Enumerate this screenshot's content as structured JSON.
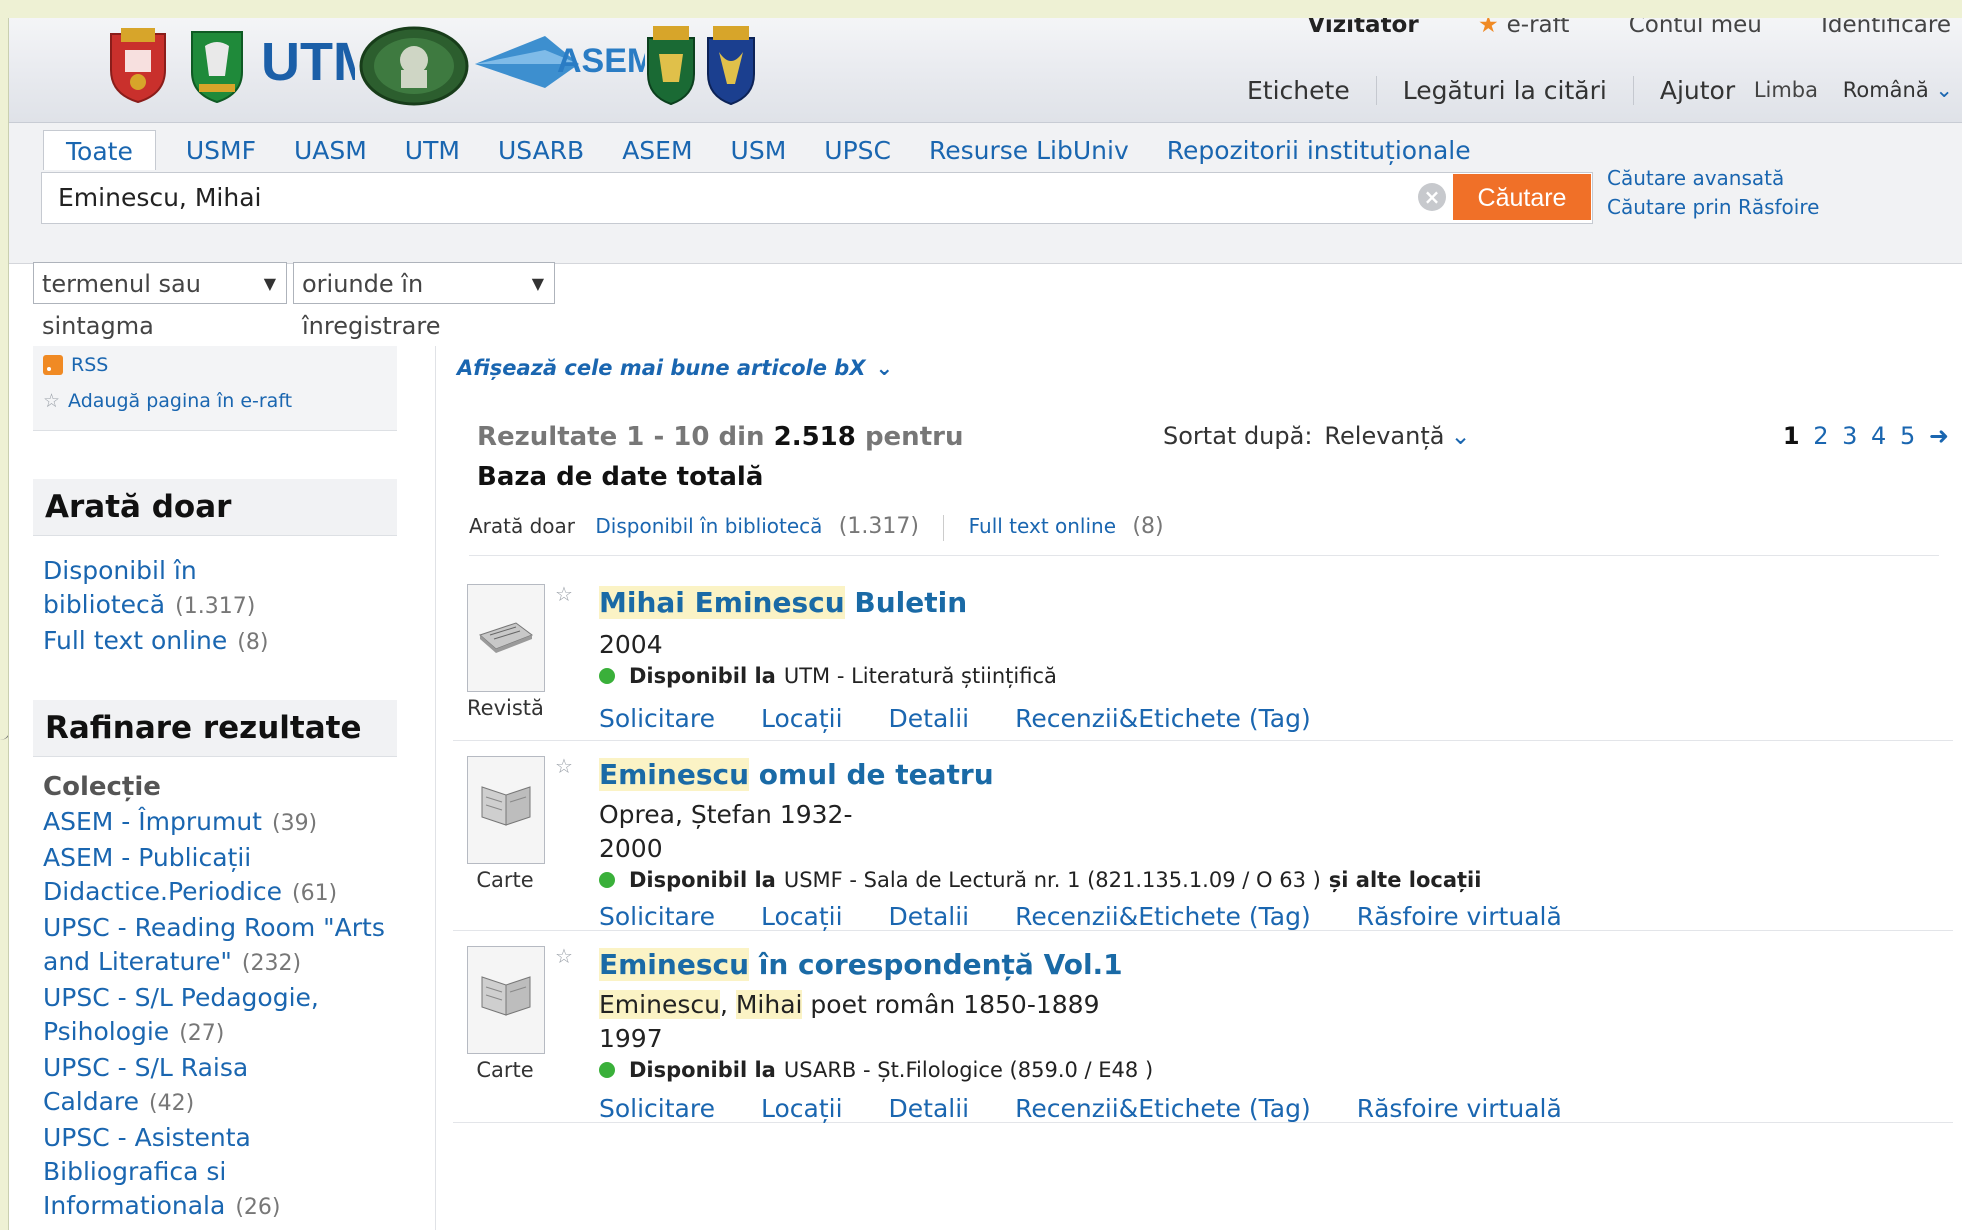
{
  "header": {
    "top_links": [
      "Vizitator",
      "e-raft",
      "Contul meu",
      "Identificare"
    ],
    "nav": [
      "Etichete",
      "Legături la citări",
      "Ajutor"
    ],
    "language_label": "Limba",
    "language_value": "Română",
    "logos": [
      "usmf-crest",
      "uasm-crest",
      "utm-logo",
      "upsc-seal",
      "asem-logo",
      "usm-crest",
      "usarb-crest"
    ],
    "logo_text_utm": "UTM",
    "logo_text_asem": "ASEM"
  },
  "search": {
    "tabs": [
      "Toate",
      "USMF",
      "UASM",
      "UTM",
      "USARB",
      "ASEM",
      "USM",
      "UPSC",
      "Resurse LibUniv",
      "Repozitorii instituționale"
    ],
    "active_tab": "Toate",
    "query": "Eminescu, Mihai",
    "button": "Căutare",
    "advanced_link": "Căutare avansată",
    "browse_link": "Căutare prin Răsfoire",
    "filter_term": "termenul sau sintagma",
    "filter_where": "oriunde în înregistrare"
  },
  "sidebar": {
    "rss": "RSS",
    "add_page": "Adaugă pagina în e-raft",
    "show_only_title": "Arată doar",
    "show_only": [
      {
        "label": "Disponibil în bibliotecă",
        "count": "(1.317)"
      },
      {
        "label": "Full text online",
        "count": "(8)"
      }
    ],
    "refine_title": "Rafinare rezultate",
    "collection_title": "Colecție",
    "collections": [
      {
        "label": "ASEM - Împrumut",
        "count": "(39)"
      },
      {
        "label": "ASEM - Publicații Didactice.Periodice",
        "count": "(61)"
      },
      {
        "label": "UPSC - Reading Room \"Arts and Literature\"",
        "count": "(232)"
      },
      {
        "label": "UPSC - S/L Pedagogie, Psihologie",
        "count": "(27)"
      },
      {
        "label": "UPSC - S/L Raisa Caldare",
        "count": "(42)"
      },
      {
        "label": "UPSC - Asistenta Bibliografica si Informationala",
        "count": "(26)"
      }
    ]
  },
  "results": {
    "bx_link": "Afișează cele mai bune articole bX",
    "summary_prefix": "Rezultate 1 - 10 din",
    "total": "2.518",
    "summary_suffix": "pentru",
    "database": "Baza de date totală",
    "sort_label": "Sortat după:",
    "sort_value": "Relevanță",
    "pages": [
      "1",
      "2",
      "3",
      "4",
      "5",
      "➜"
    ],
    "show_only_label": "Arată doar",
    "show_only_available": "Disponibil în bibliotecă",
    "show_only_available_count": "(1.317)",
    "show_only_fulltext": "Full text online",
    "show_only_fulltext_count": "(8)",
    "items": [
      {
        "type": "Revistă",
        "title_hl": "Mihai Eminescu",
        "title_rest": " Buletin",
        "author": "",
        "year": "2004",
        "avail_label": "Disponibil la",
        "avail_loc": "UTM - Literatură științifică",
        "actions": [
          "Solicitare",
          "Locații",
          "Detalii",
          "Recenzii&Etichete (Tag)"
        ]
      },
      {
        "type": "Carte",
        "title_hl": "Eminescu",
        "title_rest": " omul de teatru",
        "author": "Oprea, Ștefan 1932-",
        "year": "2000",
        "avail_label": "Disponibil la",
        "avail_loc": "USMF - Sala de Lectură nr. 1  (821.135.1.09 / O 63 )",
        "avail_more": "și alte locații",
        "actions": [
          "Solicitare",
          "Locații",
          "Detalii",
          "Recenzii&Etichete (Tag)",
          "Răsfoire virtuală"
        ]
      },
      {
        "type": "Carte",
        "title_hl": "Eminescu",
        "title_rest": " în corespondență Vol.1",
        "author_hl1": "Eminescu",
        "author_sep": ", ",
        "author_hl2": "Mihai",
        "author_rest": " poet român 1850-1889",
        "year": "1997",
        "avail_label": "Disponibil la",
        "avail_loc": "USARB - Șt.Filologice  (859.0 / E48 )",
        "actions": [
          "Solicitare",
          "Locații",
          "Detalii",
          "Recenzii&Etichete (Tag)",
          "Răsfoire virtuală"
        ]
      }
    ]
  },
  "colors": {
    "accent": "#1a66b0",
    "search_button": "#f07028",
    "available": "#3ab03a",
    "highlight": "#fbf3c5"
  }
}
